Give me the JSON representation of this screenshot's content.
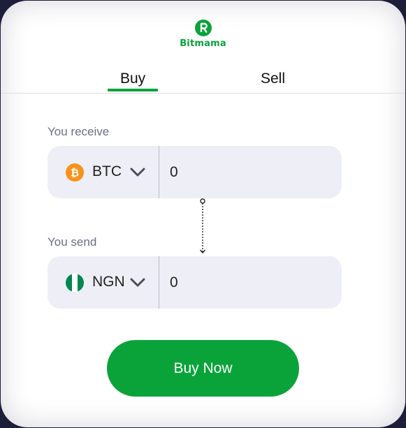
{
  "brand": {
    "name": "Bitmama",
    "color": "#0aa33a",
    "icon": "bitmama-logo"
  },
  "tabs": [
    {
      "label": "Buy",
      "active": true
    },
    {
      "label": "Sell",
      "active": false
    }
  ],
  "receive": {
    "label": "You receive",
    "currency": {
      "code": "BTC",
      "icon": "bitcoin-icon"
    },
    "amount": "0"
  },
  "send": {
    "label": "You send",
    "currency": {
      "code": "NGN",
      "icon": "nigeria-flag-icon"
    },
    "amount": "0"
  },
  "action": {
    "label": "Buy Now"
  }
}
